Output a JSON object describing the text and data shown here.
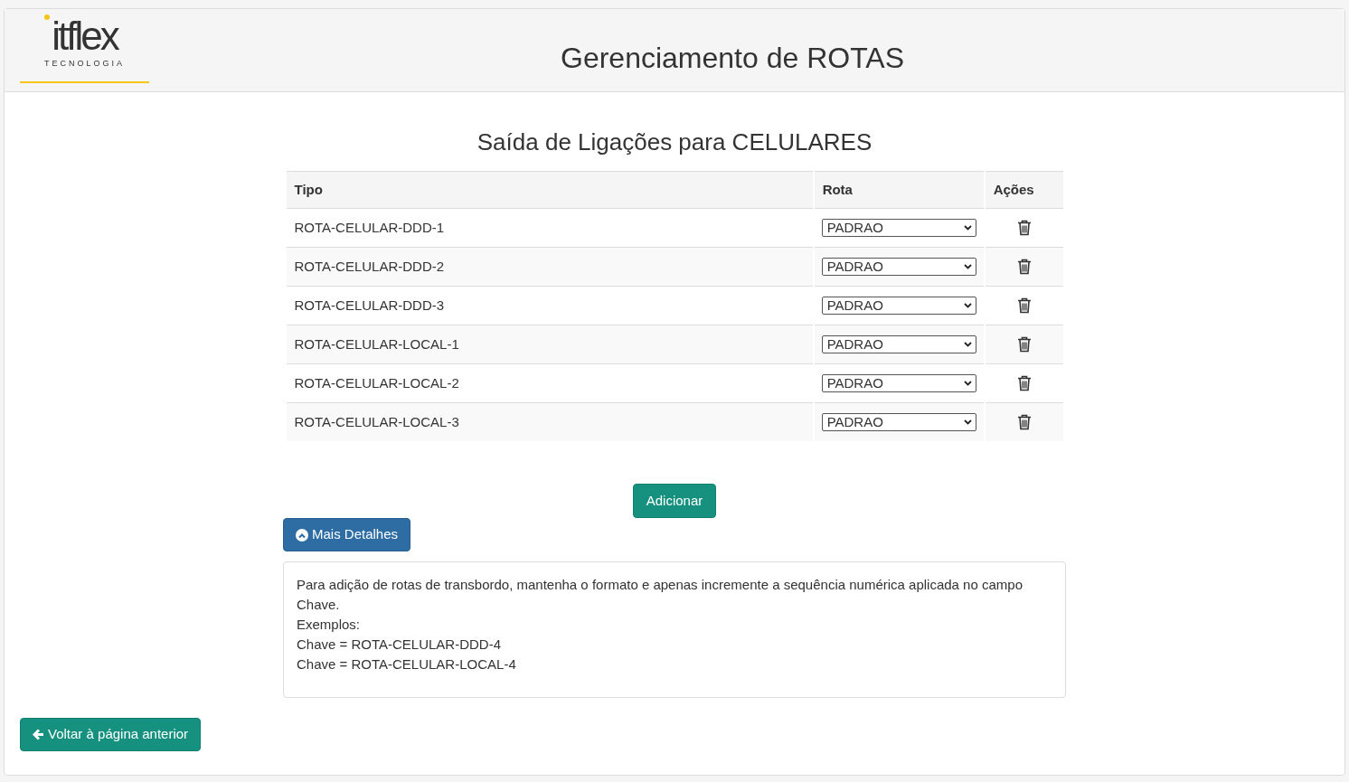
{
  "header": {
    "logo_wordmark": "itflex",
    "logo_tagline": "TECNOLOGIA",
    "title": "Gerenciamento de ROTAS"
  },
  "section_title": "Saída de Ligações para CELULARES",
  "table": {
    "columns": [
      "Tipo",
      "Rota",
      "Ações"
    ],
    "rows": [
      {
        "tipo": "ROTA-CELULAR-DDD-1",
        "rota": "PADRAO"
      },
      {
        "tipo": "ROTA-CELULAR-DDD-2",
        "rota": "PADRAO"
      },
      {
        "tipo": "ROTA-CELULAR-DDD-3",
        "rota": "PADRAO"
      },
      {
        "tipo": "ROTA-CELULAR-LOCAL-1",
        "rota": "PADRAO"
      },
      {
        "tipo": "ROTA-CELULAR-LOCAL-2",
        "rota": "PADRAO"
      },
      {
        "tipo": "ROTA-CELULAR-LOCAL-3",
        "rota": "PADRAO"
      }
    ]
  },
  "add_button": "Adicionar",
  "details_button": {
    "label": "Mais Detalhes",
    "expanded": true
  },
  "details_lines": [
    "Para adição de rotas de transbordo, mantenha o formato e apenas incremente a sequência numérica aplicada no campo Chave.",
    "Exemplos:",
    "Chave = ROTA-CELULAR-DDD-4",
    "Chave = ROTA-CELULAR-LOCAL-4"
  ],
  "back_button": "Voltar à página anterior"
}
